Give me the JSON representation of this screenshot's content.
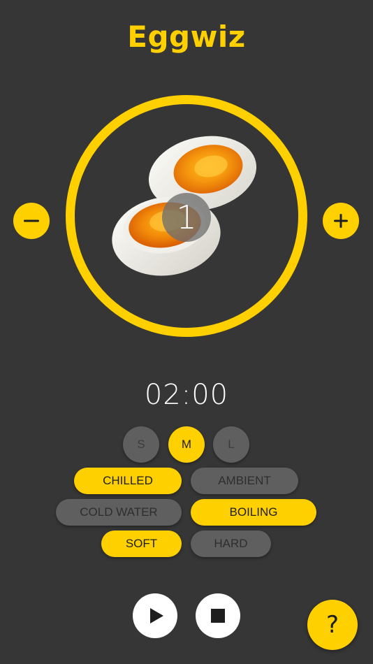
{
  "app": {
    "title": "Eggwiz"
  },
  "egg": {
    "count": "1",
    "image": "two-halved-soft-boiled-eggs"
  },
  "timer": {
    "display": "02:00"
  },
  "sizes": {
    "items": [
      {
        "label": "S",
        "selected": false
      },
      {
        "label": "M",
        "selected": true
      },
      {
        "label": "L",
        "selected": false
      }
    ]
  },
  "start_temp": {
    "chilled": "CHILLED",
    "ambient": "AMBIENT",
    "selected": "CHILLED"
  },
  "water": {
    "cold": "COLD WATER",
    "boiling": "BOILING",
    "selected": "BOILING"
  },
  "doneness": {
    "soft": "SOFT",
    "hard": "HARD",
    "selected": "SOFT"
  },
  "controls": {
    "minus_icon": "minus-icon",
    "plus_icon": "plus-icon",
    "play_icon": "play-icon",
    "stop_icon": "stop-icon",
    "help_label": "?"
  },
  "colors": {
    "background": "#363636",
    "accent": "#FFD000",
    "inactive": "#5f5f5f",
    "control": "#ffffff"
  }
}
